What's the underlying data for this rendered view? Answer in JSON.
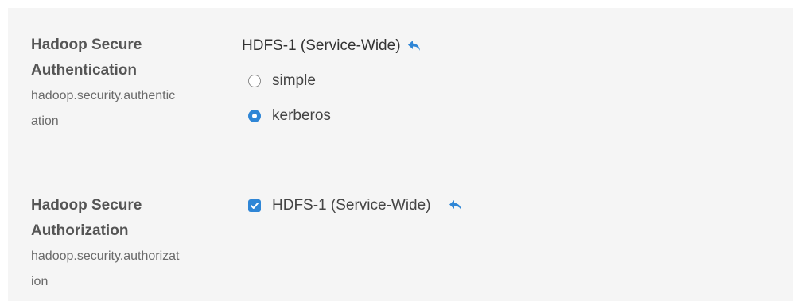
{
  "settings": [
    {
      "title_line1": "Hadoop Secure",
      "title_line2": "Authentication",
      "key_line1": "hadoop.security.authentic",
      "key_line2": "ation",
      "scope": "HDFS-1 (Service-Wide)",
      "options": [
        {
          "label": "simple",
          "selected": false
        },
        {
          "label": "kerberos",
          "selected": true
        }
      ]
    },
    {
      "title_line1": "Hadoop Secure",
      "title_line2": "Authorization",
      "key_line1": "hadoop.security.authorizat",
      "key_line2": "ion",
      "checkbox_label": "HDFS-1 (Service-Wide)",
      "checked": true
    }
  ],
  "icons": {
    "undo": "undo-arrow-icon"
  },
  "colors": {
    "accent": "#2f86d6",
    "panel_bg": "#f5f5f5",
    "title_text": "#555555",
    "key_text": "#6a6a6a"
  }
}
